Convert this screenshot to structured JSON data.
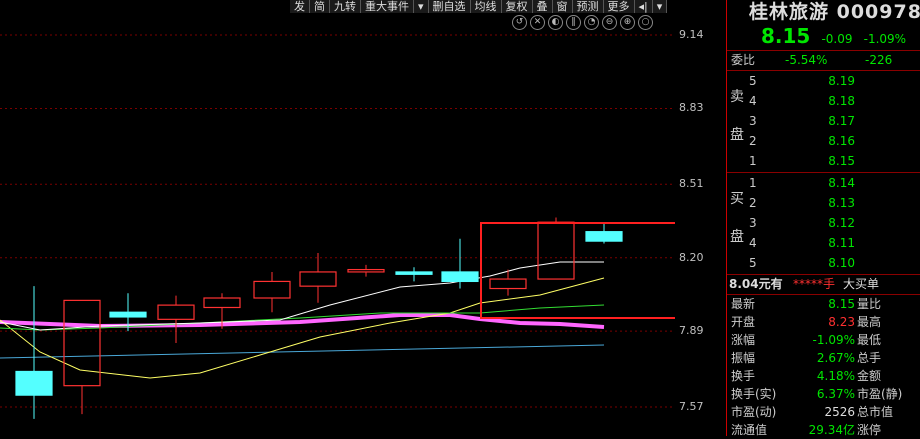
{
  "toolbar": {
    "buttons": [
      "发",
      "简",
      "九转",
      "重大事件",
      "▾",
      "删自选",
      "均线",
      "复权",
      "叠",
      "窗",
      "预测",
      "更多",
      "◂|",
      "▾"
    ]
  },
  "icon_bar": [
    "↺",
    "✕",
    "◐",
    "‖",
    "◔",
    "⊖",
    "⊕",
    "○"
  ],
  "price_axis": {
    "ticks": [
      "9.14",
      "8.83",
      "8.51",
      "8.20",
      "7.89",
      "7.57"
    ]
  },
  "stock": {
    "name_code": "桂林旅游 000978",
    "price": "8.15",
    "change": "-0.09",
    "change_pct": "-1.09%"
  },
  "weibi": {
    "label": "委比",
    "ratio": "-5.54%",
    "diff": "-226"
  },
  "sell_side_label": [
    "卖",
    "盘"
  ],
  "buy_side_label": [
    "买",
    "盘"
  ],
  "sell_levels": [
    {
      "level": "5",
      "price": "8.19"
    },
    {
      "level": "4",
      "price": "8.18"
    },
    {
      "level": "3",
      "price": "8.17"
    },
    {
      "level": "2",
      "price": "8.16"
    },
    {
      "level": "1",
      "price": "8.15"
    }
  ],
  "buy_levels": [
    {
      "level": "1",
      "price": "8.14"
    },
    {
      "level": "2",
      "price": "8.13"
    },
    {
      "level": "3",
      "price": "8.12"
    },
    {
      "level": "4",
      "price": "8.11"
    },
    {
      "level": "5",
      "price": "8.10"
    }
  ],
  "big_order": {
    "price": "8.04元有",
    "qty": "*****手",
    "label": "大买单"
  },
  "stats": [
    {
      "label": "最新",
      "value": "8.15",
      "color": "green",
      "label2": "量比"
    },
    {
      "label": "开盘",
      "value": "8.23",
      "color": "red",
      "label2": "最高"
    },
    {
      "label": "涨幅",
      "value": "-1.09%",
      "color": "green",
      "label2": "最低"
    },
    {
      "label": "振幅",
      "value": "2.67%",
      "color": "green",
      "label2": "总手"
    },
    {
      "label": "换手",
      "value": "4.18%",
      "color": "green",
      "label2": "金额"
    },
    {
      "label": "换手(实)",
      "value": "6.37%",
      "color": "green",
      "label2": "市盈(静)"
    },
    {
      "label": "市盈(动)",
      "value": "2526",
      "color": "white",
      "label2": "总市值"
    },
    {
      "label": "流通值",
      "value": "29.34亿",
      "color": "green",
      "label2": "涨停"
    }
  ],
  "chart_data": {
    "type": "candlestick",
    "y_range": [
      7.52,
      9.2
    ],
    "y_ticks": [
      9.14,
      8.83,
      8.51,
      8.2,
      7.89,
      7.57
    ],
    "candles": [
      {
        "open": 7.72,
        "high": 8.08,
        "low": 7.52,
        "close": 7.62
      },
      {
        "open": 7.66,
        "high": 8.02,
        "low": 7.54,
        "close": 8.02
      },
      {
        "open": 7.97,
        "high": 8.05,
        "low": 7.89,
        "close": 7.95
      },
      {
        "open": 7.94,
        "high": 8.04,
        "low": 7.84,
        "close": 8.0
      },
      {
        "open": 7.99,
        "high": 8.05,
        "low": 7.9,
        "close": 8.03
      },
      {
        "open": 8.03,
        "high": 8.14,
        "low": 7.97,
        "close": 8.1
      },
      {
        "open": 8.08,
        "high": 8.22,
        "low": 8.01,
        "close": 8.14
      },
      {
        "open": 8.14,
        "high": 8.17,
        "low": 8.12,
        "close": 8.15
      },
      {
        "open": 8.14,
        "high": 8.16,
        "low": 8.1,
        "close": 8.13
      },
      {
        "open": 8.14,
        "high": 8.28,
        "low": 8.07,
        "close": 8.1
      },
      {
        "open": 8.07,
        "high": 8.15,
        "low": 8.04,
        "close": 8.11
      },
      {
        "open": 8.11,
        "high": 8.37,
        "low": 8.11,
        "close": 8.35
      },
      {
        "open": 8.31,
        "high": 8.35,
        "low": 8.26,
        "close": 8.27
      },
      {
        "open": 8.23,
        "high": 8.24,
        "low": 8.11,
        "close": 8.15
      }
    ],
    "colors": {
      "up": "#ff3232",
      "down": "#54ffff",
      "ma_white": "#ffffff",
      "ma_yellow": "#ffff66",
      "ma_green": "#33dd33",
      "ma_magenta": "#ff66ff",
      "ma_blue": "#4aa8d8",
      "highlight": "#ff2020"
    }
  }
}
